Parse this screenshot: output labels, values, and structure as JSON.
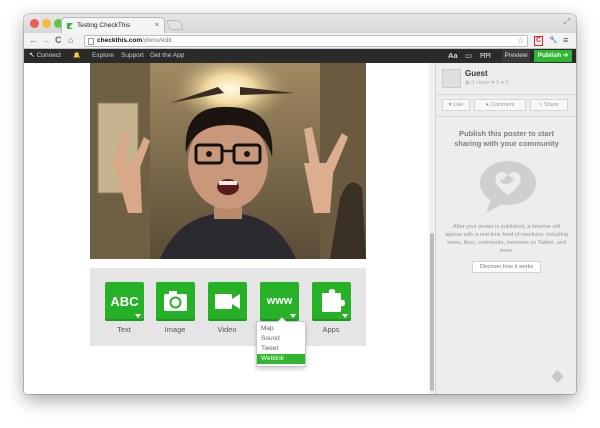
{
  "browser": {
    "tab_title": "Testing CheckThis",
    "tab_close": "×",
    "url_host": "checkthis.com",
    "url_path": "/dwnv/edit",
    "back": "←",
    "forward": "→",
    "reload": "C",
    "home": "⌂",
    "star": "☆",
    "fullscreen": "⤢",
    "ext_badge": "C",
    "wrench": "🔧",
    "menu": "≡"
  },
  "site_nav": {
    "connect": "Connect",
    "bell": "🔔",
    "explore": "Explore",
    "support": "Support",
    "get_app": "Get the App",
    "font_tool": "Aa",
    "image_tool": "▭",
    "layout_tool": "ĦĦ",
    "preview": "Preview",
    "publish": "Publish"
  },
  "media_bar": {
    "buttons": [
      {
        "icon_text": "ABC",
        "label": "Text"
      },
      {
        "icon_text": "",
        "label": "Image"
      },
      {
        "icon_text": "",
        "label": "Video"
      },
      {
        "icon_text": "www",
        "label": ""
      },
      {
        "icon_text": "",
        "label": "Apps"
      }
    ],
    "dropdown": [
      "Map",
      "Sound",
      "Tweet",
      "Weblink"
    ]
  },
  "sidebar": {
    "user": "Guest",
    "views": "0 views",
    "likes": "0",
    "comments": "0",
    "like_btn": "Like",
    "comment_btn": "Comment",
    "share_btn": "Share",
    "prompt_title": "Publish this poster to start sharing with your community",
    "prompt_desc": "After your poster is published, a timeline will appear with a real-time feed of reactions, including views, likes, comments, mentions on Twitter, and more.",
    "discover": "Discover how it works"
  },
  "colors": {
    "accent": "#2fb82f",
    "button_green": "#26b126",
    "nav_bg": "#2b2b2b",
    "sidebar_bg": "#ededed"
  }
}
